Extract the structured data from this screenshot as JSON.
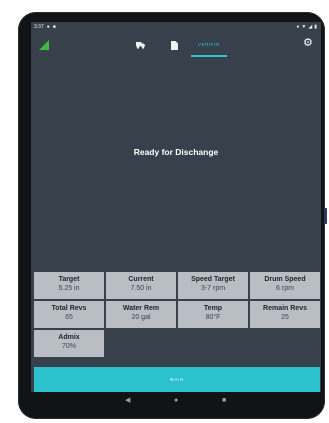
{
  "statusbar": {
    "time": "3:37",
    "left_icons": [
      "location-icon",
      "notification-icon"
    ],
    "right_icons": [
      "location-icon",
      "wifi-icon",
      "signal-icon",
      "battery-icon"
    ]
  },
  "appbar": {
    "tabs": [
      {
        "icon": "truck-icon"
      },
      {
        "icon": "document-icon"
      },
      {
        "label": "VERIFIR",
        "active": true
      }
    ],
    "accent_color": "#2cc3cf"
  },
  "main": {
    "message": "Ready for Dischange"
  },
  "metrics": [
    {
      "label": "Target",
      "value": "5.25 in"
    },
    {
      "label": "Current",
      "value": "7.50 in"
    },
    {
      "label": "Speed Target",
      "value": "3-7 rpm"
    },
    {
      "label": "Drum Speed",
      "value": "6 rpm"
    },
    {
      "label": "Total Revs",
      "value": "65"
    },
    {
      "label": "Water Rem",
      "value": "20 gal"
    },
    {
      "label": "Temp",
      "value": "80°F"
    },
    {
      "label": "Remain Revs",
      "value": "25"
    },
    {
      "label": "Admix",
      "value": "70%"
    }
  ],
  "footer": {
    "main_button_label": "MAIN",
    "main_button_color": "#2cc2cd"
  },
  "system_nav": {
    "back": "◀",
    "home": "●",
    "recents": "■"
  }
}
